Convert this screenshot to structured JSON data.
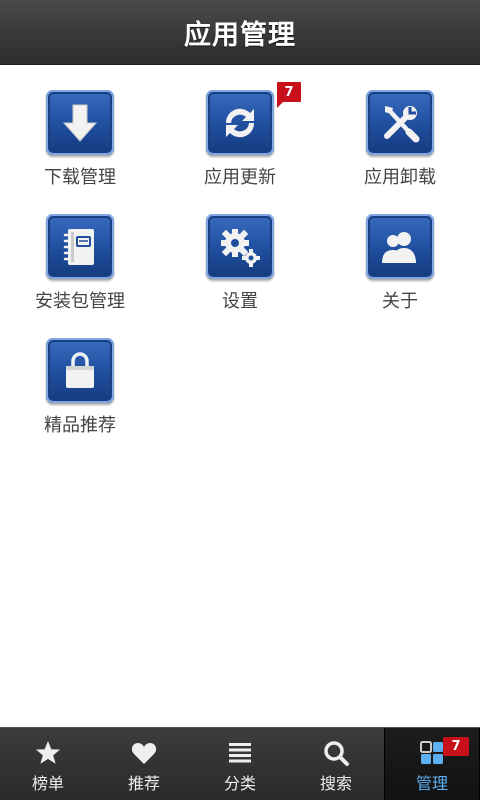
{
  "header": {
    "title": "应用管理"
  },
  "grid": {
    "items": [
      {
        "label": "下载管理",
        "icon": "download-arrow-icon"
      },
      {
        "label": "应用更新",
        "icon": "refresh-icon",
        "badge": "7"
      },
      {
        "label": "应用卸载",
        "icon": "tools-icon"
      },
      {
        "label": "安装包管理",
        "icon": "notebook-icon"
      },
      {
        "label": "设置",
        "icon": "gears-icon"
      },
      {
        "label": "关于",
        "icon": "users-icon"
      },
      {
        "label": "精品推荐",
        "icon": "bag-icon"
      }
    ]
  },
  "nav": {
    "items": [
      {
        "label": "榜单",
        "icon": "star-icon"
      },
      {
        "label": "推荐",
        "icon": "heart-icon"
      },
      {
        "label": "分类",
        "icon": "list-icon"
      },
      {
        "label": "搜索",
        "icon": "search-icon"
      },
      {
        "label": "管理",
        "icon": "grid-icon",
        "badge": "7",
        "active": true
      }
    ]
  },
  "colors": {
    "header_bg": "#3a3a3a",
    "icon_blue": "#1f4e9e",
    "badge_red": "#c8101a",
    "nav_active_label": "#5fb0f0"
  }
}
